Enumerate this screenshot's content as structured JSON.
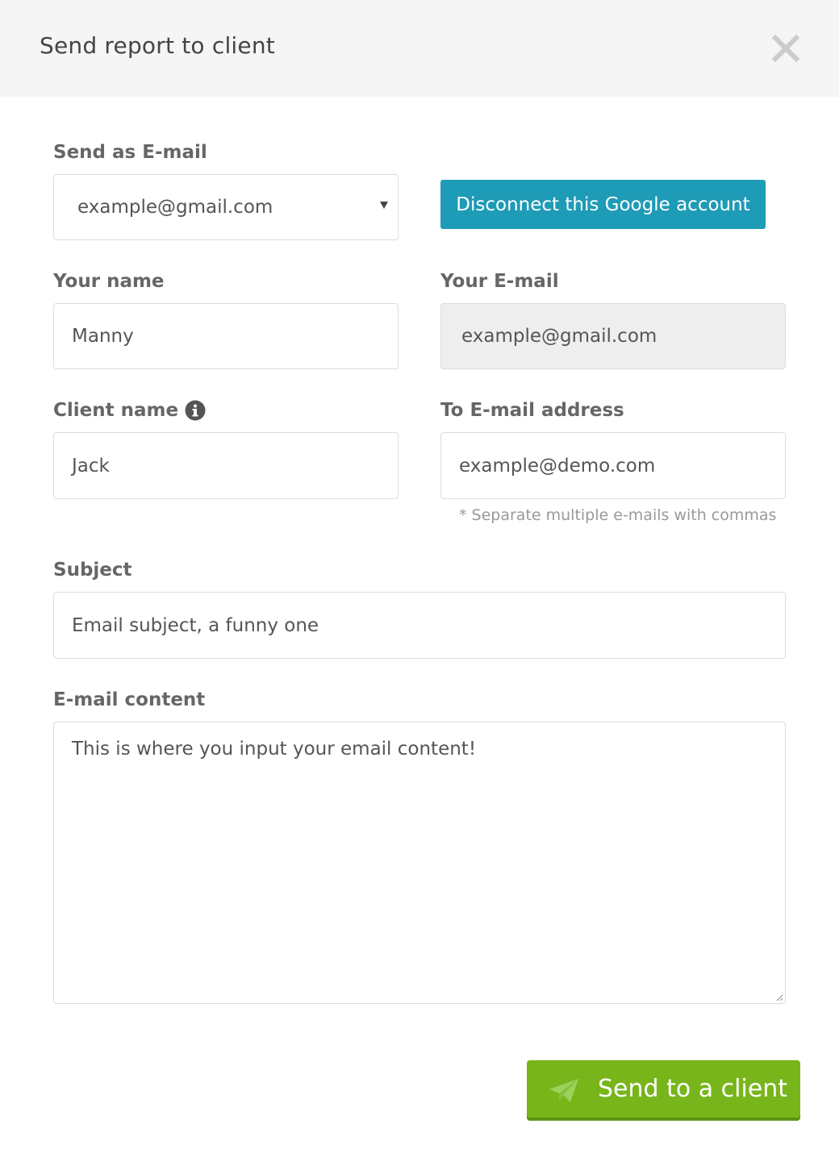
{
  "dialog": {
    "title": "Send report to client",
    "close_icon": "close-icon"
  },
  "send_as": {
    "label": "Send as E-mail",
    "selected": "example@gmail.com",
    "disconnect_label": "Disconnect this Google account"
  },
  "your_name": {
    "label": "Your name",
    "value": "Manny"
  },
  "your_email": {
    "label": "Your E-mail",
    "value": "example@gmail.com"
  },
  "client_name": {
    "label": "Client name",
    "value": "Jack",
    "info_icon": "info-icon"
  },
  "to_email": {
    "label": "To E-mail address",
    "value": "example@demo.com",
    "hint": "* Separate multiple e-mails with commas"
  },
  "subject": {
    "label": "Subject",
    "value": "Email subject, a funny one"
  },
  "content": {
    "label": "E-mail content",
    "value": "This is where you input your email content!"
  },
  "send_button": {
    "label": "Send to a client",
    "icon": "paper-plane-icon"
  },
  "colors": {
    "header_bg": "#f5f5f5",
    "disconnect_bg": "#1e9bb6",
    "send_bg": "#78b51b",
    "label_text": "#666666"
  }
}
